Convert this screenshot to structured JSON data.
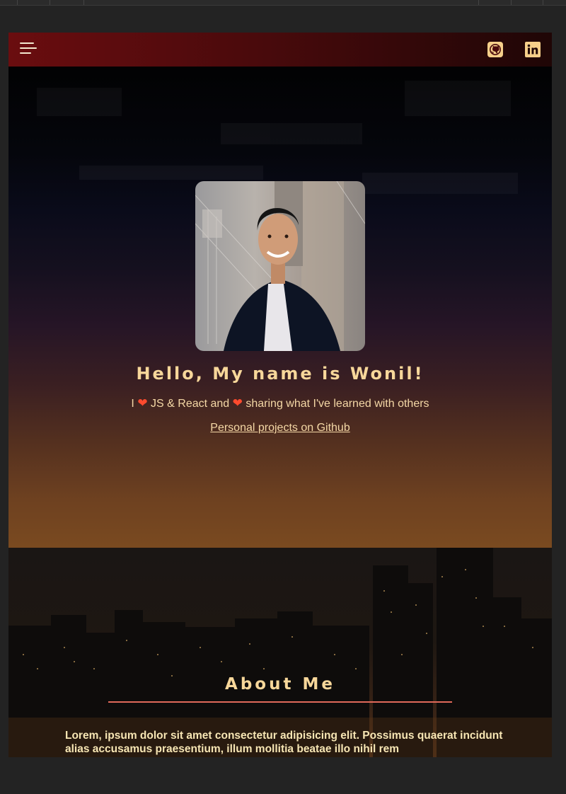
{
  "nav": {
    "menu_icon": "hamburger-menu-icon",
    "github_icon": "github-icon",
    "linkedin_icon": "linkedin-icon"
  },
  "hero": {
    "greeting": "Hello, My name is Wonil!",
    "tagline_part1": "I",
    "tagline_part2": "JS & React and",
    "tagline_part3": "sharing what I've learned with others",
    "heart_glyph": "❤",
    "github_link": "Personal projects on Github"
  },
  "about": {
    "title": "About Me",
    "text": "Lorem, ipsum dolor sit amet consectetur adipisicing elit. Possimus quaerat incidunt alias accusamus praesentium, illum mollitia beatae illo nihil rem"
  },
  "colors": {
    "accent_text": "#f7d79a",
    "heart": "#ff4a2e",
    "rule": "#e0695a",
    "nav_start": "#6a0d0f"
  }
}
